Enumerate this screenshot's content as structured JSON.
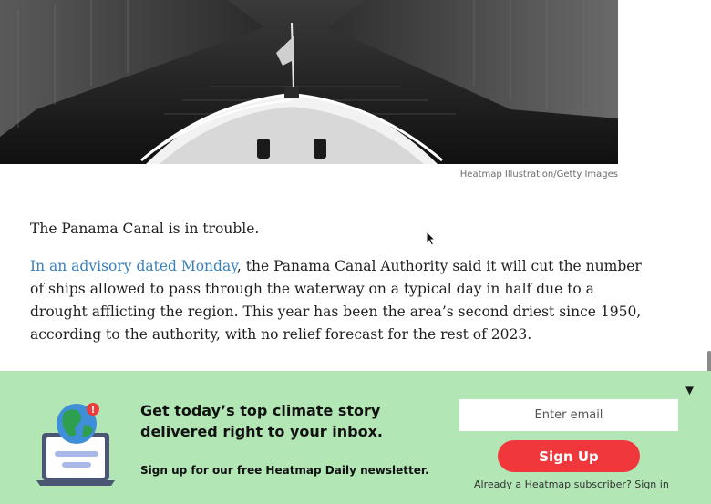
{
  "hero": {
    "caption": "Heatmap Illustration/Getty Images"
  },
  "article": {
    "paragraph1": "The Panama Canal is in trouble.",
    "paragraph2_link": "In an advisory dated Monday",
    "paragraph2_rest": ", the Panama Canal Authority said it will cut the number of ships allowed to pass through the waterway on a typical day in half due to a drought afflicting the region. This year has been the area’s second driest since 1950, according to the authority, with no relief forecast for the rest of 2023."
  },
  "newsletter": {
    "close_icon": "▼",
    "headline": "Get today’s top climate story delivered right to your inbox.",
    "subline": "Sign up for our free Heatmap Daily newsletter.",
    "email_placeholder": "Enter email",
    "signup_label": "Sign Up",
    "already_text": "Already a Heatmap subscriber?",
    "signin_label": "Sign in",
    "illustration_icon": "laptop-globe-icon",
    "notification_badge": "!",
    "colors": {
      "banner_bg": "#b2e6b5",
      "signup_bg": "#f0383c",
      "link": "#3a7fb8"
    }
  }
}
